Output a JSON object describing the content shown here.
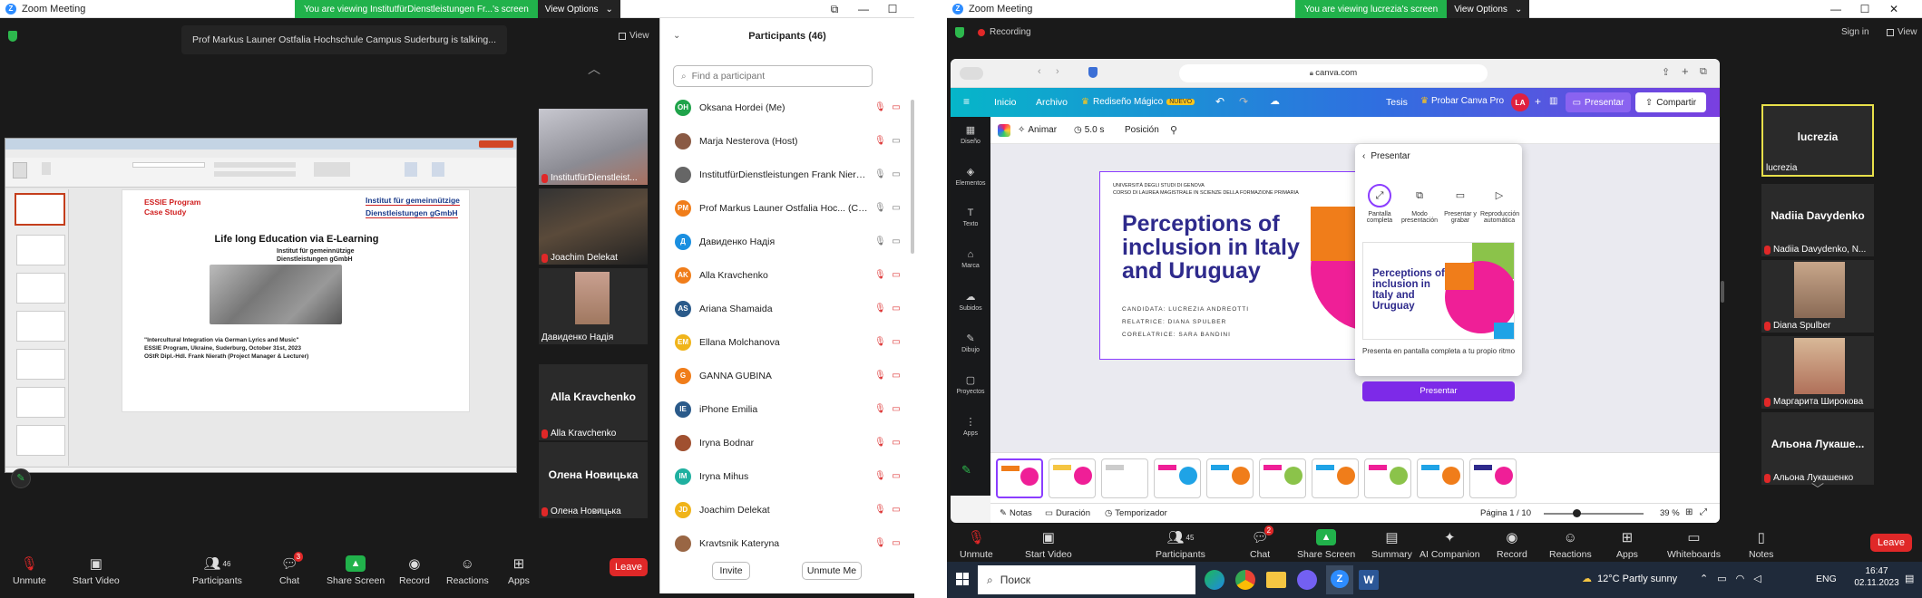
{
  "left": {
    "title": "Zoom Meeting",
    "banner_msg": "You are viewing InstitutfürDienstleistungen Fr...'s screen",
    "banner_opt": "View Options",
    "talking": "Prof Markus Launer Ostfalia Hochschule Campus Suderburg is talking...",
    "view_label": "View",
    "slide": {
      "essie": "ESSIE Program",
      "case": "Case Study",
      "inst1": "Institut für gemeinnützige",
      "inst2": "Dienstleistungen gGmbH",
      "title": "Life long Education via E-Learning",
      "logo1": "Institut für gemeinnützige",
      "logo2": "Dienstleistungen gGmbH",
      "foot1": "\"Intercultural Integration via German Lyrics and Music\"",
      "foot2": "ESSIE Program, Ukraine, Suderburg, October 31st, 2023",
      "foot3": "OStR Dipl.-Hdl. Frank Nierath (Project Manager & Lecturer)"
    },
    "tiles": [
      "InstitutfürDienstleist...",
      "Joachim Delekat",
      "Давиденко Надія",
      "Alla Kravchenko",
      "Олена Новицька"
    ],
    "tile_big": [
      "Alla Kravchenko",
      "Олена Новицька"
    ],
    "controls": {
      "unmute": "Unmute",
      "start_video": "Start Video",
      "participants": "Participants",
      "participants_count": "46",
      "chat": "Chat",
      "chat_badge": "3",
      "share": "Share Screen",
      "record": "Record",
      "reactions": "Reactions",
      "apps": "Apps",
      "leave": "Leave"
    },
    "panel": {
      "title": "Participants (46)",
      "search_placeholder": "Find a participant",
      "rows": [
        {
          "initials": "OH",
          "color": "#1fa34a",
          "name": "Oksana Hordei (Me)"
        },
        {
          "initials": "",
          "color": "#8a5a44",
          "name": "Marja Nesterova (Host)"
        },
        {
          "initials": "",
          "color": "#666666",
          "name": "InstitutfürDienstleistungen Frank Nierath"
        },
        {
          "initials": "PM",
          "color": "#f07d1a",
          "name": "Prof Markus Launer Ostfalia Hoc... (Co-host)"
        },
        {
          "initials": "Д",
          "color": "#1a8fe0",
          "name": "Давиденко Надія"
        },
        {
          "initials": "AK",
          "color": "#f07d1a",
          "name": "Alla Kravchenko"
        },
        {
          "initials": "AS",
          "color": "#2a5a8a",
          "name": "Ariana Shamaida"
        },
        {
          "initials": "EM",
          "color": "#f0b41a",
          "name": "Ellana Molchanova"
        },
        {
          "initials": "G",
          "color": "#f07d1a",
          "name": "GANNA GUBINA"
        },
        {
          "initials": "IE",
          "color": "#2a5a8a",
          "name": "iPhone Emilia"
        },
        {
          "initials": "",
          "color": "#a05030",
          "name": "Iryna Bodnar"
        },
        {
          "initials": "IM",
          "color": "#1fb0a0",
          "name": "Iryna Mihus"
        },
        {
          "initials": "JD",
          "color": "#f0b41a",
          "name": "Joachim Delekat"
        },
        {
          "initials": "",
          "color": "#996644",
          "name": "Kravtsnik Kateryna"
        }
      ],
      "invite": "Invite",
      "unmute_me": "Unmute Me"
    }
  },
  "right": {
    "title": "Zoom Meeting",
    "recording": "Recording",
    "banner_msg": "You are viewing lucrezia's screen",
    "banner_opt": "View Options",
    "sign_in": "Sign in",
    "view_label": "View",
    "browser_url": "canva.com",
    "canva": {
      "menu": [
        "Inicio",
        "Archivo"
      ],
      "magic": "Rediseño Mágico",
      "new": "NUEVO",
      "tesis": "Tesis",
      "pro": "Probar Canva Pro",
      "avatar": "LA",
      "present": "Presentar",
      "share": "Compartir",
      "toolbar": {
        "animate": "Animar",
        "time": "5.0 s",
        "pos": "Posición"
      },
      "side": [
        "Diseño",
        "Elementos",
        "Texto",
        "Marca",
        "Subidos",
        "Dibujo",
        "Proyectos",
        "Apps"
      ],
      "slide": {
        "uni1": "UNIVERSITÀ DEGLI STUDI DI GENOVA",
        "uni2": "CORSO DI LAUREA MAGISTRALE IN SCIENZE DELLA FORMAZIONE PRIMARIA",
        "title": "Perceptions of inclusion in Italy and Uruguay",
        "cand": "CANDIDATA: LUCREZIA ANDREOTTI",
        "rel": "RELATRICE: DIANA SPULBER",
        "corel": "CORELATRICE: SARA BANDINI"
      },
      "present_panel": {
        "title": "Presentar",
        "opts": [
          "Pantalla completa",
          "Modo presentación",
          "Presentar y grabar",
          "Reproducción automática"
        ],
        "desc": "Presenta en pantalla completa a tu propio ritmo",
        "button": "Presentar"
      },
      "bottom": {
        "notas": "Notas",
        "duracion": "Duración",
        "temp": "Temporizador",
        "page": "Página 1 / 10",
        "zoom": "39 %"
      }
    },
    "tiles": [
      {
        "big": "lucrezia",
        "name": "lucrezia"
      },
      {
        "big": "Nadiia Davydenko",
        "name": "Nadiia Davydenko, N..."
      },
      {
        "big": "",
        "name": "Diana Spulber"
      },
      {
        "big": "",
        "name": "Маргарита Широкова"
      },
      {
        "big": "Альона Лукаше...",
        "name": "Альона Лукашенко"
      }
    ],
    "controls": {
      "unmute": "Unmute",
      "start_video": "Start Video",
      "participants": "Participants",
      "participants_count": "45",
      "chat": "Chat",
      "chat_badge": "2",
      "share": "Share Screen",
      "summary": "Summary",
      "ai": "AI Companion",
      "record": "Record",
      "reactions": "Reactions",
      "apps": "Apps",
      "whiteboards": "Whiteboards",
      "notes": "Notes",
      "leave": "Leave"
    },
    "taskbar": {
      "search": "Поиск",
      "weather": "12°C Partly sunny",
      "lang": "ENG",
      "time": "16:47",
      "date": "02.11.2023"
    }
  }
}
